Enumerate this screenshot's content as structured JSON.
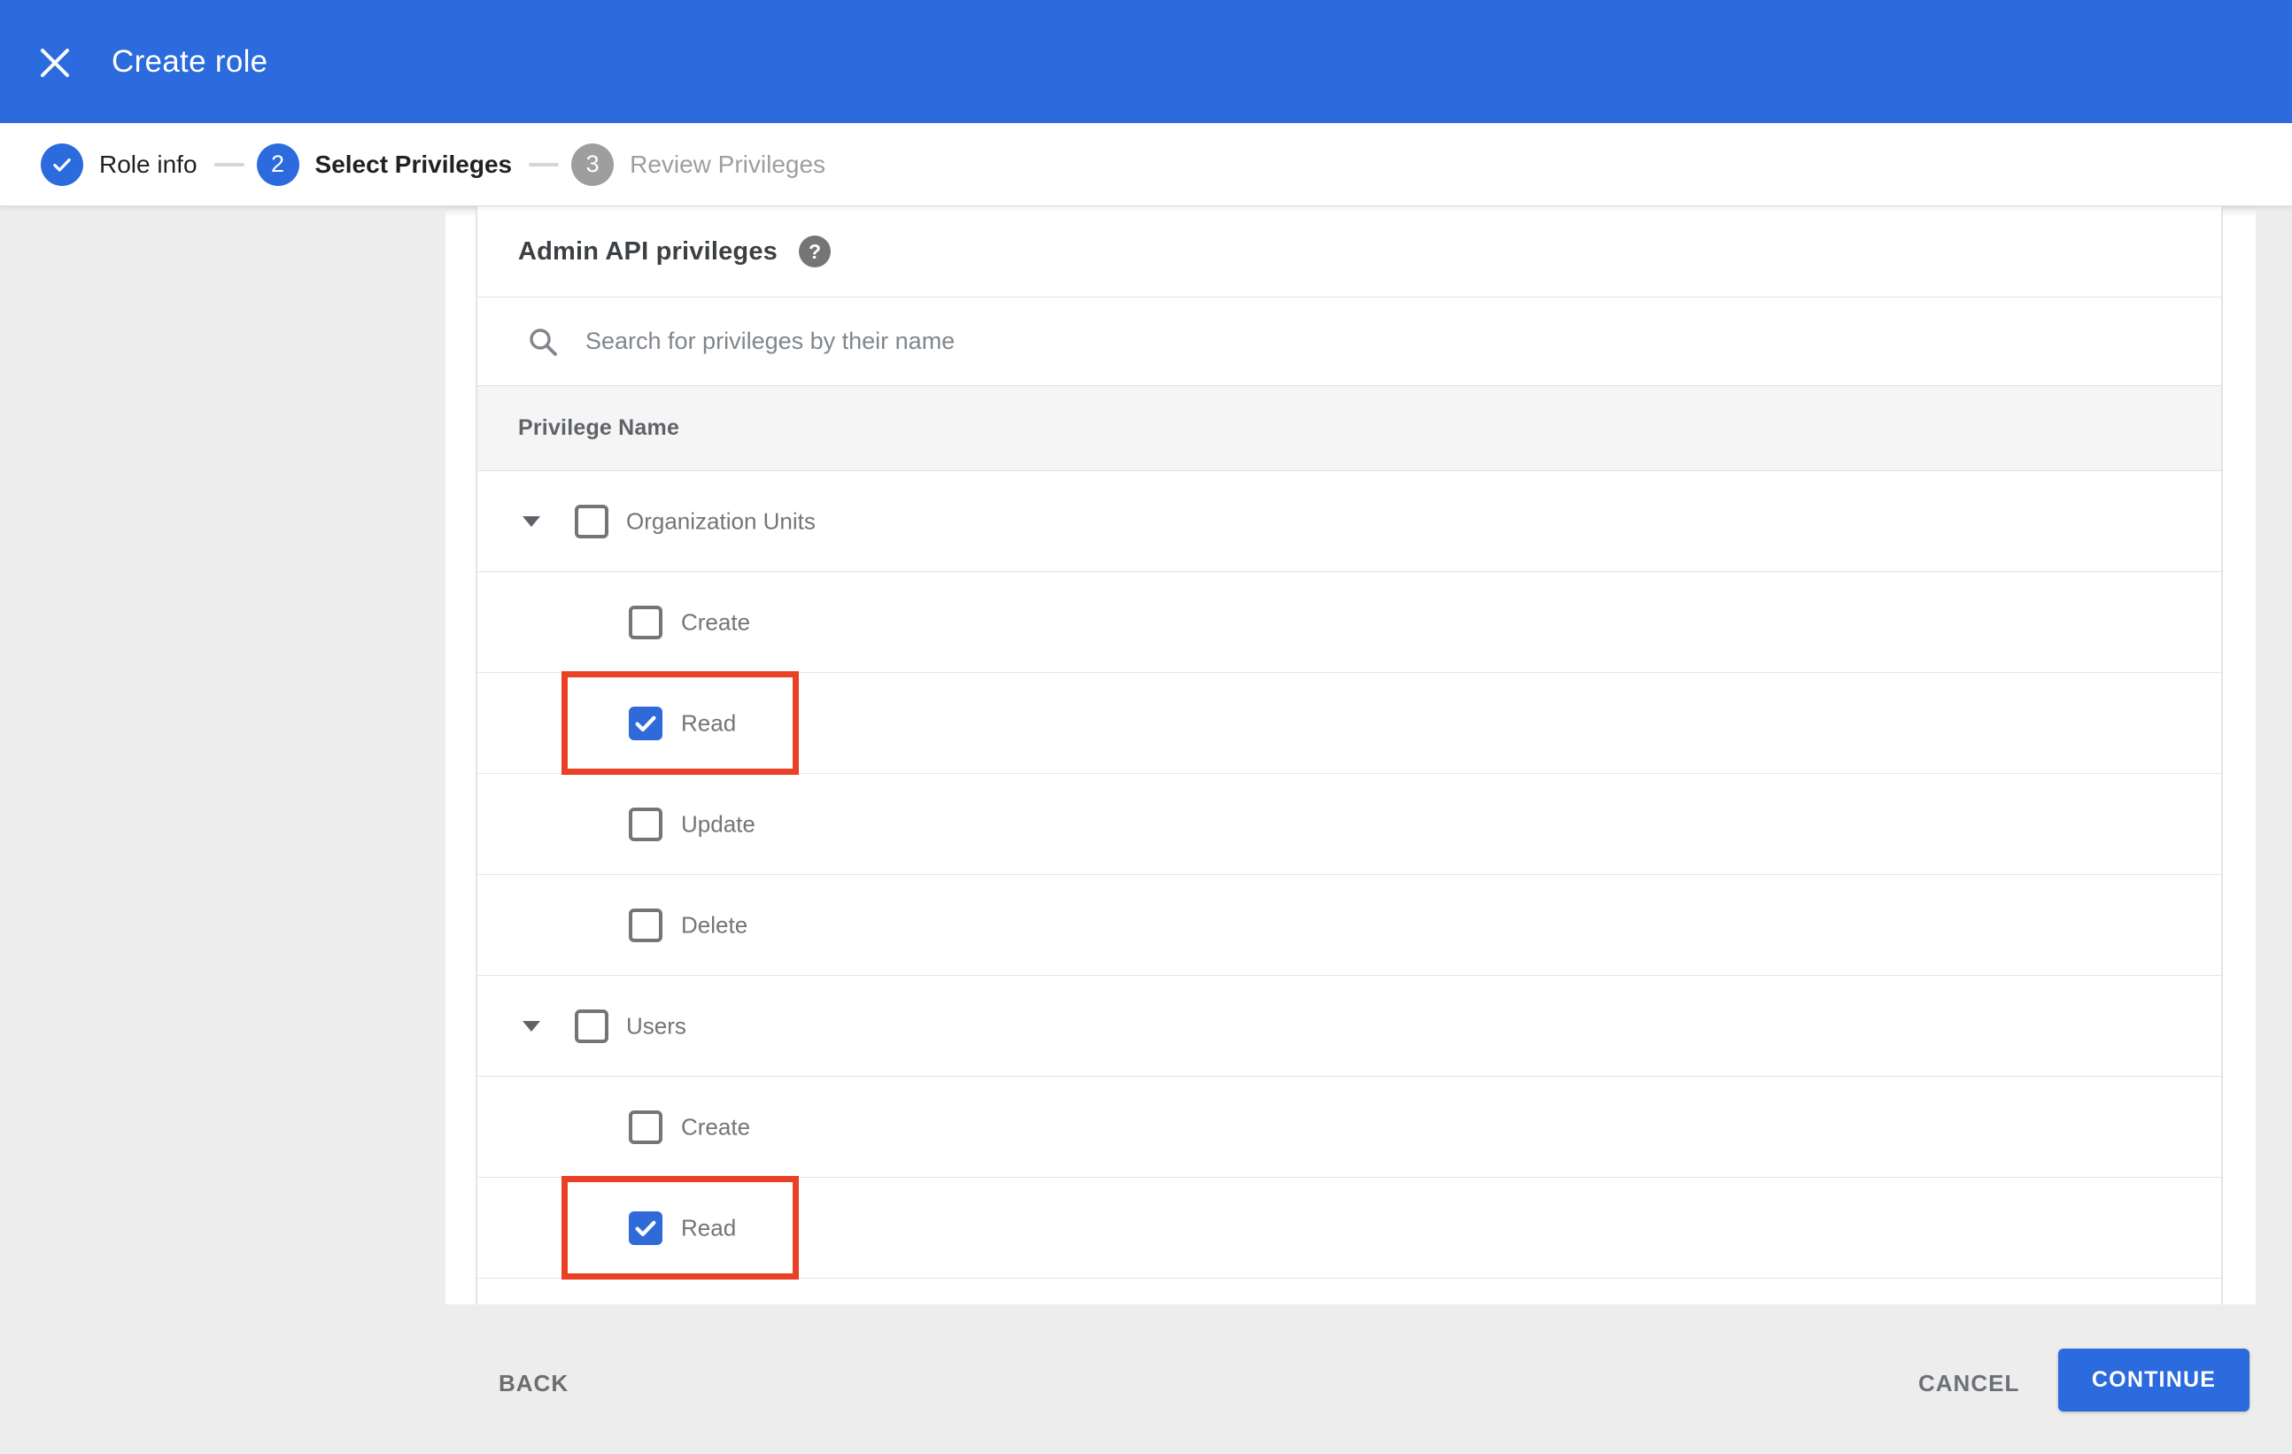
{
  "appbar": {
    "title": "Create role",
    "background_color": "#2b6bdd"
  },
  "stepper": {
    "steps": [
      {
        "number": "",
        "label": "Role info",
        "state": "complete"
      },
      {
        "number": "2",
        "label": "Select Privileges",
        "state": "active"
      },
      {
        "number": "3",
        "label": "Review Privileges",
        "state": "upcoming"
      }
    ]
  },
  "panel": {
    "heading": "Admin API privileges",
    "help_icon_glyph": "?",
    "search_placeholder": "Search for privileges by their name",
    "column_header": "Privilege Name"
  },
  "privileges": [
    {
      "label": "Organization Units",
      "level": "parent",
      "expanded": true,
      "checked": false,
      "annotated": false
    },
    {
      "label": "Create",
      "level": "child",
      "expanded": null,
      "checked": false,
      "annotated": false
    },
    {
      "label": "Read",
      "level": "child",
      "expanded": null,
      "checked": true,
      "annotated": true
    },
    {
      "label": "Update",
      "level": "child",
      "expanded": null,
      "checked": false,
      "annotated": false
    },
    {
      "label": "Delete",
      "level": "child",
      "expanded": null,
      "checked": false,
      "annotated": false
    },
    {
      "label": "Users",
      "level": "parent",
      "expanded": true,
      "checked": false,
      "annotated": false
    },
    {
      "label": "Create",
      "level": "child",
      "expanded": null,
      "checked": false,
      "annotated": false
    },
    {
      "label": "Read",
      "level": "child",
      "expanded": null,
      "checked": true,
      "annotated": true
    }
  ],
  "footer": {
    "back_label": "BACK",
    "cancel_label": "CANCEL",
    "continue_label": "CONTINUE"
  },
  "colors": {
    "accent_blue": "#2b6bdd",
    "checkbox_checked_blue": "#2f6ad8",
    "annotation_red": "#ea4026",
    "page_background": "#ededed",
    "table_header_background": "#f5f5f5",
    "inactive_gray": "#9e9e9e"
  }
}
